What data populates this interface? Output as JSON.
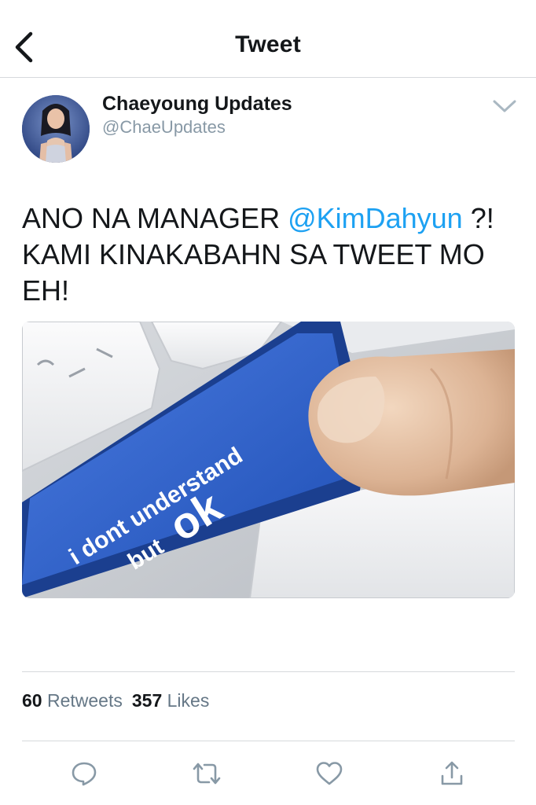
{
  "header": {
    "title": "Tweet"
  },
  "author": {
    "name": "Chaeyoung Updates",
    "handle": "@ChaeUpdates"
  },
  "tweet": {
    "text_before": "ANO NA MANAGER ",
    "mention": "@KimDahyun",
    "text_after": " ?! KAMI KINAKABAHN SA TWEET MO EH!"
  },
  "media": {
    "line1": "i dont understand",
    "line2": "but",
    "line3": "ok"
  },
  "stats": {
    "retweets_count": "60",
    "retweets_label": "Retweets",
    "likes_count": "357",
    "likes_label": "Likes"
  },
  "icons": {
    "back": "chevron-left-icon",
    "caret": "chevron-down-icon",
    "reply": "reply-icon",
    "retweet": "retweet-icon",
    "like": "heart-icon",
    "share": "share-icon"
  },
  "colors": {
    "link": "#1da1f2",
    "icon_gray": "#8899a6",
    "text": "#14171a",
    "key_blue": "#2f5fc4"
  }
}
